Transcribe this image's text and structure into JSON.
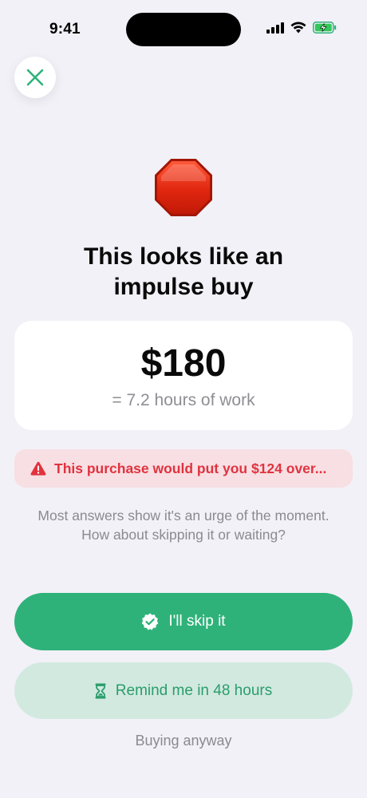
{
  "status_bar": {
    "time": "9:41"
  },
  "icons": {
    "close": "close-icon",
    "stop": "stop-sign-icon",
    "warning": "warning-triangle-icon",
    "skip": "verified-check-badge-icon",
    "remind": "hourglass-icon"
  },
  "colors": {
    "accent_green": "#2fb27a",
    "light_green": "#d2e9e0",
    "warning_red": "#e0333f",
    "warning_bg": "#f7dfe3",
    "background": "#f2f1f7"
  },
  "headline": {
    "line1": "This looks like an",
    "line2": "impulse buy"
  },
  "price_card": {
    "amount": "$180",
    "hours": "= 7.2 hours of work"
  },
  "warning": {
    "text": "This purchase would put you $124 over..."
  },
  "advice": {
    "line1": "Most answers show it's an urge of the moment.",
    "line2": "How about skipping it or waiting?"
  },
  "actions": {
    "skip_label": "I'll skip it",
    "remind_label": "Remind me in 48 hours",
    "buy_anyway_label": "Buying anyway"
  }
}
